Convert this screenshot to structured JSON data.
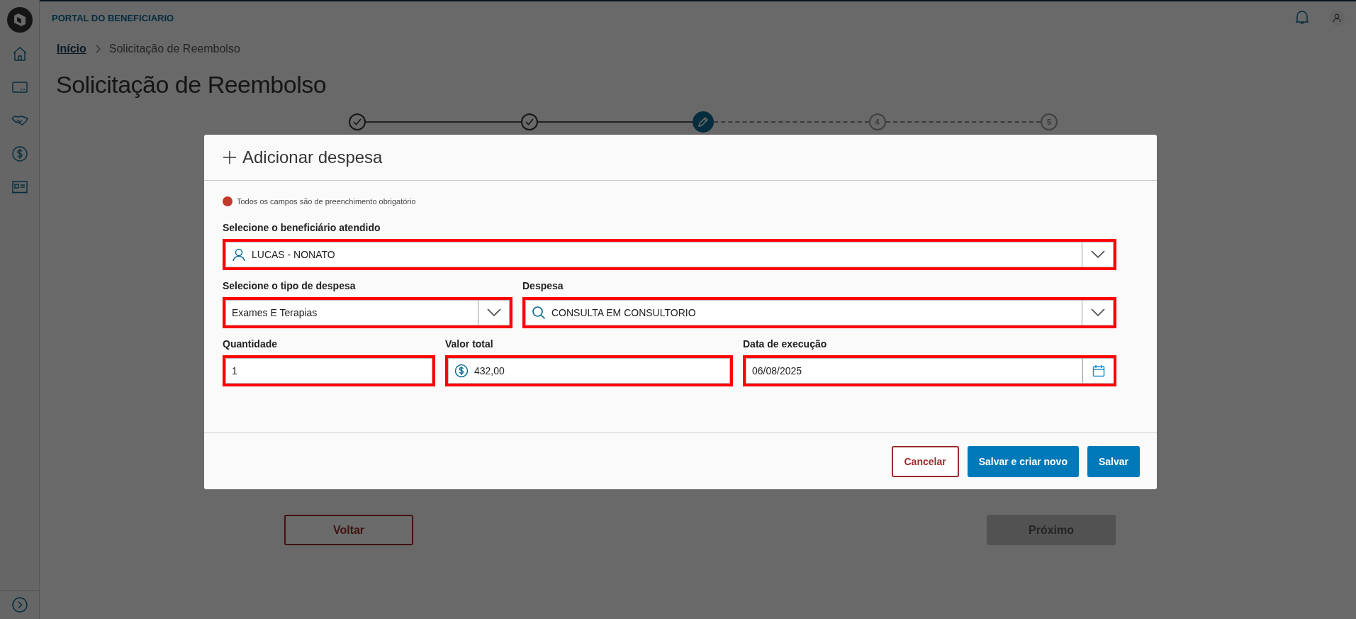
{
  "header": {
    "title": "PORTAL DO BENEFICIARIO"
  },
  "breadcrumb": [
    {
      "label": "Início",
      "kind": "link"
    },
    {
      "label": "Solicitação de Reembolso",
      "kind": "current"
    }
  ],
  "page_title": "Solicitação de Reembolso",
  "stepper": [
    {
      "kind": "done"
    },
    {
      "kind": "done"
    },
    {
      "kind": "current"
    },
    {
      "kind": "pending",
      "label": "4"
    },
    {
      "kind": "pending",
      "label": "5"
    }
  ],
  "page_buttons": [
    {
      "label": "Voltar",
      "kind": "outline",
      "disabled": false
    },
    {
      "label": "Próximo",
      "kind": "primary",
      "disabled": true
    }
  ],
  "modal": {
    "title": "Adicionar despesa",
    "required_note": "Todos os campos são de preenchimento obrigatório",
    "fields": [
      {
        "label": "Selecione o beneficiário atendido",
        "value": "LUCAS - NONATO",
        "kind": "select"
      },
      {
        "label": "Selecione o tipo de despesa",
        "value": "Exames E Terapias",
        "kind": "select"
      },
      {
        "label": "Despesa",
        "value": "CONSULTA EM CONSULTORIO",
        "kind": "select"
      },
      {
        "label": "Quantidade",
        "value": "1",
        "kind": "text"
      },
      {
        "label": "Valor total",
        "value": "432,00",
        "kind": "text"
      },
      {
        "label": "Data de execução",
        "value": "06/08/2025",
        "kind": "date"
      }
    ],
    "buttons": [
      {
        "label": "Cancelar",
        "kind": "outline"
      },
      {
        "label": "Salvar e criar novo",
        "kind": "primary"
      },
      {
        "label": "Salvar",
        "kind": "primary"
      }
    ]
  }
}
